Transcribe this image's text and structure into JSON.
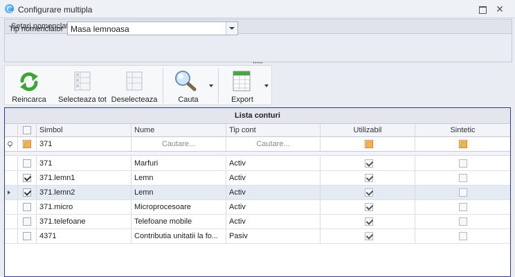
{
  "window": {
    "title": "Configurare multipla"
  },
  "settings": {
    "group_title": "Setari nomenclator",
    "tip_label": "Tip nomenclator",
    "tip_value": "Masa lemnoasa"
  },
  "toolbar": {
    "reload_label": "Reincarca",
    "select_all_label": "Selecteaza tot",
    "deselect_label": "Deselecteaza",
    "search_label": "Cauta",
    "export_label": "Export"
  },
  "grid": {
    "caption": "Lista conturi",
    "columns": {
      "simbol": "Simbol",
      "nume": "Nume",
      "tip_cont": "Tip cont",
      "utilizabil": "Utilizabil",
      "sintetic": "Sintetic"
    },
    "filter": {
      "simbol": "371",
      "nume_placeholder": "Cautare...",
      "tip_placeholder": "Cautare..."
    },
    "rows": [
      {
        "selected": false,
        "simbol": "371",
        "nume": "Marfuri",
        "tip": "Activ",
        "utilizabil": true,
        "sintetic": false
      },
      {
        "selected": true,
        "simbol": "371.lemn1",
        "nume": "Lemn",
        "tip": "Activ",
        "utilizabil": true,
        "sintetic": false
      },
      {
        "selected": true,
        "simbol": "371.lemn2",
        "nume": "Lemn",
        "tip": "Activ",
        "utilizabil": true,
        "sintetic": false
      },
      {
        "selected": false,
        "simbol": "371.micro",
        "nume": "Microprocesoare",
        "tip": "Activ",
        "utilizabil": true,
        "sintetic": false
      },
      {
        "selected": false,
        "simbol": "371.telefoane",
        "nume": "Telefoane mobile",
        "tip": "Activ",
        "utilizabil": true,
        "sintetic": false
      },
      {
        "selected": false,
        "simbol": "4371",
        "nume": "Contributia unitatii la fo...",
        "tip": "Pasiv",
        "utilizabil": true,
        "sintetic": false
      }
    ],
    "focused_row": 2
  },
  "icons": [
    "app-icon",
    "reload-icon",
    "select-all-icon",
    "deselect-icon",
    "search-icon",
    "export-icon",
    "restore-icon",
    "close-icon"
  ],
  "colors": {
    "accent_border": "#303a8a",
    "filter_check": "#f4b24a",
    "focused_row": "#e4ebf4"
  }
}
